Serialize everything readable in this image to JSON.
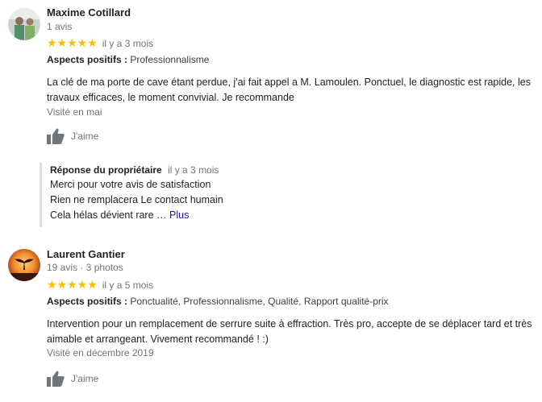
{
  "reviews": [
    {
      "author": "Maxime Cotillard",
      "author_meta": "1 avis",
      "stars": "★★★★★",
      "rating_value": 5,
      "time": "il y a 3 mois",
      "aspects_label": "Aspects positifs :",
      "aspects": "Professionnalisme",
      "text": "La clé de ma porte de cave étant perdue, j'ai fait appel a M. Lamoulen. Ponctuel, le diagnostic est rapide, les travaux efficaces, le moment convivial. Je recommande",
      "visited": "Visité en mai",
      "like_label": "J'aime",
      "reply": {
        "title": "Réponse du propriétaire",
        "time": "il y a 3 mois",
        "lines": [
          "Merci pour votre avis de satisfaction",
          "Rien ne remplacera Le contact humain",
          "Cela hélas dévient rare …"
        ],
        "more_label": "Plus"
      }
    },
    {
      "author": "Laurent Gantier",
      "author_meta": "19 avis · 3 photos",
      "stars": "★★★★★",
      "rating_value": 5,
      "time": "il y a 5 mois",
      "aspects_label": "Aspects positifs :",
      "aspects": "Ponctualité, Professionnalisme, Qualité, Rapport qualité-prix",
      "text": "Intervention pour un remplacement de serrure suite à effraction. Très pro, accepte de se déplacer tard et très aimable et arrangeant. Vivement recommandé ! :)",
      "visited": "Visité en décembre 2019",
      "like_label": "J'aime"
    }
  ],
  "colors": {
    "star": "#fbbc04",
    "muted": "#70757a",
    "link": "#1a0dab",
    "reply_border": "#dadce0"
  },
  "icons": {
    "like": "thumb-up-icon"
  }
}
